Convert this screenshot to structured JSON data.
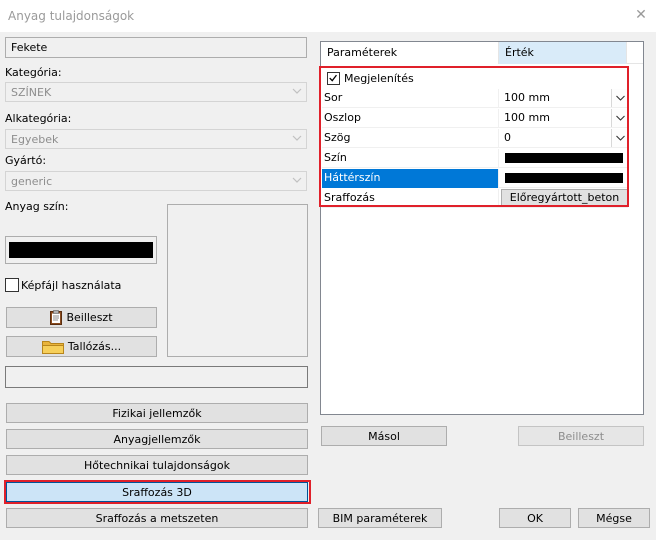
{
  "window": {
    "title": "Anyag tulajdonságok",
    "close_glyph": "✕"
  },
  "left": {
    "name_value": "Fekete",
    "category_label": "Kategória:",
    "category_value": "SZÍNEK",
    "subcategory_label": "Alkategória:",
    "subcategory_value": "Egyebek",
    "manufacturer_label": "Gyártó:",
    "manufacturer_value": "generic",
    "material_color_label": "Anyag szín:",
    "material_color": "#000000",
    "use_image_label": "Képfájl használata",
    "paste_label": "Beilleszt",
    "browse_label": "Tallózás...",
    "path_value": "",
    "buttons": {
      "physical": "Fizikai jellemzők",
      "material": "Anyagjellemzők",
      "thermal": "Hőtechnikai tulajdonságok",
      "hatch3d": "Sraffozás 3D",
      "hatch_section": "Sraffozás a metszeten"
    }
  },
  "grid": {
    "header_param": "Paraméterek",
    "header_value": "Érték",
    "display_label": "Megjelenítés",
    "rows": [
      {
        "name": "Sor",
        "value": "100 mm"
      },
      {
        "name": "Oszlop",
        "value": "100 mm"
      },
      {
        "name": "Szög",
        "value": "0"
      },
      {
        "name": "Szín",
        "value": ""
      },
      {
        "name": "Háttérszín",
        "value": ""
      },
      {
        "name": "Sraffozás",
        "value": "Előregyártott_beton"
      }
    ],
    "color_swatch": "#000000",
    "bg_swatch": "#000000",
    "selection_color": "#0078d7"
  },
  "right_buttons": {
    "copy": "Másol",
    "paste": "Beilleszt"
  },
  "footer": {
    "bim": "BIM paraméterek",
    "ok": "OK",
    "cancel": "Mégse"
  },
  "accent_red": "#e0202a"
}
